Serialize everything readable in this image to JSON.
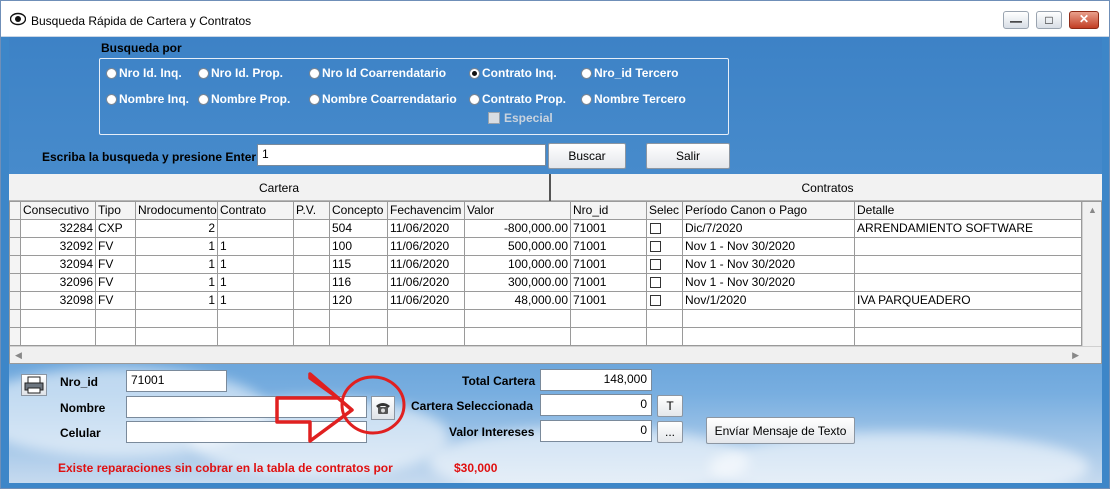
{
  "window": {
    "title": "Busqueda Rápida de Cartera y Contratos",
    "minimize_icon": "minimize-icon",
    "maximize_icon": "maximize-icon",
    "close_icon": "close-icon"
  },
  "search": {
    "group_title": "Busqueda por",
    "options_row1": [
      "Nro Id. Inq.",
      "Nro Id. Prop.",
      "Nro Id Coarrendatario",
      "Contrato Inq.",
      "Nro_id Tercero"
    ],
    "options_row2": [
      "Nombre Inq.",
      "Nombre Prop.",
      "Nombre Coarrendatario",
      "Contrato Prop.",
      "Nombre Tercero"
    ],
    "selected": "Contrato Inq.",
    "especial_label": "Especial",
    "prompt_label": "Escriba la busqueda y presione Enter",
    "query_value": "1",
    "buscar_label": "Buscar",
    "salir_label": "Salir"
  },
  "tabs": {
    "cartera": "Cartera",
    "contratos": "Contratos"
  },
  "table": {
    "columns": [
      "Consecutivo",
      "Tipo",
      "Nrodocumento",
      "Contrato",
      "P.V.",
      "Concepto",
      "Fechavencim",
      "Valor",
      "Nro_id",
      "Selec",
      "Período Canon o Pago",
      "Detalle"
    ],
    "rows": [
      [
        "32284",
        "CXP",
        "2",
        "",
        "",
        "504",
        "11/06/2020",
        "-800,000.00",
        "71001",
        "",
        "Dic/7/2020",
        "ARRENDAMIENTO SOFTWARE"
      ],
      [
        "32092",
        "FV",
        "1",
        "1",
        "",
        "100",
        "11/06/2020",
        "500,000.00",
        "71001",
        "",
        "Nov 1 - Nov 30/2020",
        ""
      ],
      [
        "32094",
        "FV",
        "1",
        "1",
        "",
        "115",
        "11/06/2020",
        "100,000.00",
        "71001",
        "",
        "Nov 1 - Nov 30/2020",
        ""
      ],
      [
        "32096",
        "FV",
        "1",
        "1",
        "",
        "116",
        "11/06/2020",
        "300,000.00",
        "71001",
        "",
        "Nov 1 - Nov 30/2020",
        ""
      ],
      [
        "32098",
        "FV",
        "1",
        "1",
        "",
        "120",
        "11/06/2020",
        "48,000.00",
        "71001",
        "",
        "Nov/1/2020",
        "IVA PARQUEADERO"
      ]
    ]
  },
  "details": {
    "nro_id_label": "Nro_id",
    "nro_id_value": "71001",
    "nombre_label": "Nombre",
    "nombre_value": "",
    "celular_label": "Celular",
    "celular_value": "",
    "total_cartera_label": "Total Cartera",
    "total_cartera_value": "148,000",
    "cartera_sel_label": "Cartera Seleccionada",
    "cartera_sel_value": "0",
    "t_button": "T",
    "valor_intereses_label": "Valor Intereses",
    "valor_intereses_value": "0",
    "ellipsis_button": "...",
    "sms_button": "Envíar Mensaje de Texto",
    "print_icon": "printer-icon",
    "phone_icon": "telephone-icon"
  },
  "footer": {
    "message": "Existe reparaciones sin cobrar en la tabla de contratos por",
    "amount": "$30,000"
  },
  "colors": {
    "window_blue": "#3d86c8",
    "alert_red": "#e01010",
    "annotation_red": "#e02020"
  }
}
